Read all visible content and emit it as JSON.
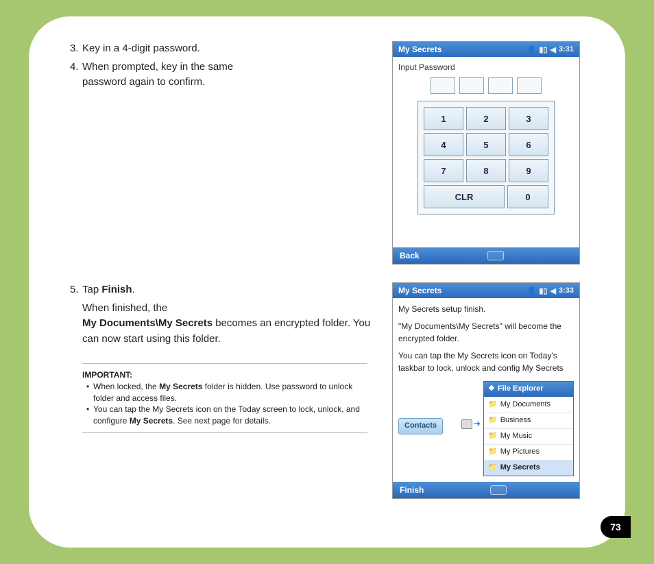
{
  "steps": {
    "s3": "Key in a 4-digit password.",
    "s4": "When prompted, key in the same password again to confirm.",
    "s5_intro": "Tap ",
    "s5_bold": "Finish",
    "s5_period": ".",
    "s5_body_a": "When finished, the",
    "s5_body_b1": "My Documents\\My Secrets",
    "s5_body_b2": " becomes an encrypted folder. You can now start using this folder."
  },
  "important": {
    "label": "IMPORTANT:",
    "b1a": "When locked, the ",
    "b1b": "My Secrets",
    "b1c": " folder is hidden. Use password to unlock folder and access files.",
    "b2a": "You can tap the My Secrets icon on the Today screen to lock, unlock, and configure ",
    "b2b": "My Secrets",
    "b2c": ". See next page for details."
  },
  "phone1": {
    "title": "My Secrets",
    "time": "3:31",
    "prompt": "Input Password",
    "keys": [
      "1",
      "2",
      "3",
      "4",
      "5",
      "6",
      "7",
      "8",
      "9",
      "CLR",
      "0"
    ],
    "back": "Back"
  },
  "phone2": {
    "title": "My Secrets",
    "time": "3:33",
    "line1": "My Secrets setup finish.",
    "line2": "\"My Documents\\My Secrets\" will become the encrypted folder.",
    "line3": "You can tap the My Secrets icon on Today's taskbar to lock, unlock and config My Secrets",
    "contacts": "Contacts",
    "menu_head": "File Explorer",
    "menu_items": [
      "My Documents",
      "Business",
      "My Music",
      "My Pictures",
      "My Secrets"
    ],
    "finish": "Finish"
  },
  "page_number": "73"
}
